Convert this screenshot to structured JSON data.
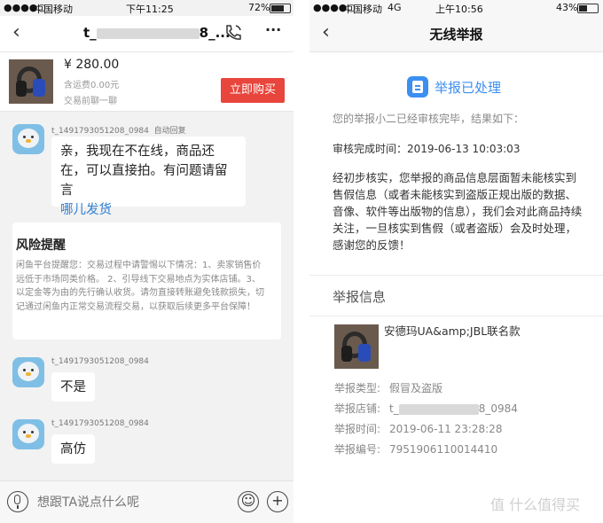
{
  "left": {
    "status": {
      "carrier": "中国移动",
      "time": "下午11:25",
      "battery": "72%"
    },
    "nav": {
      "back_icon": "‹",
      "title": "t_",
      "title_tail": "8_...",
      "more": "···"
    },
    "product": {
      "price": "¥ 280.00",
      "shipping": "含运费0.00元",
      "negotiate": "交易前聊一聊",
      "buy_label": "立即购买"
    },
    "messages": [
      {
        "sender": "t_1491793051208_0984",
        "tag": "自动回复",
        "text": "亲，我现在不在线，商品还在，可以直接拍。有问题请留言",
        "link": "哪儿发货"
      },
      {
        "sender": "t_1491793051208_0984",
        "text": "不是"
      },
      {
        "sender": "t_1491793051208_0984",
        "text": "高仿"
      }
    ],
    "warning": {
      "title": "风险提醒",
      "body": "闲鱼平台提醒您：交易过程中请警惕以下情况：1、卖家销售价远低于市场同类价格。 2、引导线下交易地点为实体店铺。3、以定金等为由的先行确认收货。请勿直接转账避免钱款损失，切记通过闲鱼内正常交易流程交易，以获取后续更多平台保障！"
    },
    "input": {
      "placeholder": "想跟TA说点什么呢",
      "emoji": "☺",
      "plus": "+"
    }
  },
  "right": {
    "status": {
      "carrier": "中国移动",
      "network": "4G",
      "time": "上午10:56",
      "battery": "43%"
    },
    "nav": {
      "back_icon": "‹",
      "title": "无线举报"
    },
    "result": {
      "title": "举报已处理",
      "intro": "您的举报小二已经审核完毕，结果如下：",
      "complete_time": "审核完成时间：2019-06-13 10:03:03",
      "body": "经初步核实，您举报的商品信息层面暂未能核实到售假信息（或者未能核实到盗版正规出版的数据、音像、软件等出版物的信息），我们会对此商品持续关注，一旦核实到售假（或者盗版）会及时处理，感谢您的反馈！"
    },
    "report": {
      "section_title": "举报信息",
      "item_name": "安德玛UA&amp;JBL联名款",
      "type_label": "举报类型:",
      "type_value": "假冒及盗版",
      "shop_label": "举报店铺:",
      "shop_value_prefix": "t_",
      "shop_value_suffix": "8_0984",
      "time_label": "举报时间:",
      "time_value": "2019-06-11 23:28:28",
      "id_label": "举报编号:",
      "id_value": "7951906110014410"
    },
    "watermark": "值 什么值得买"
  },
  "colors": {
    "accent_red": "#e8453c",
    "link_blue": "#2f7fd0",
    "badge_blue": "#3b8ff0"
  }
}
